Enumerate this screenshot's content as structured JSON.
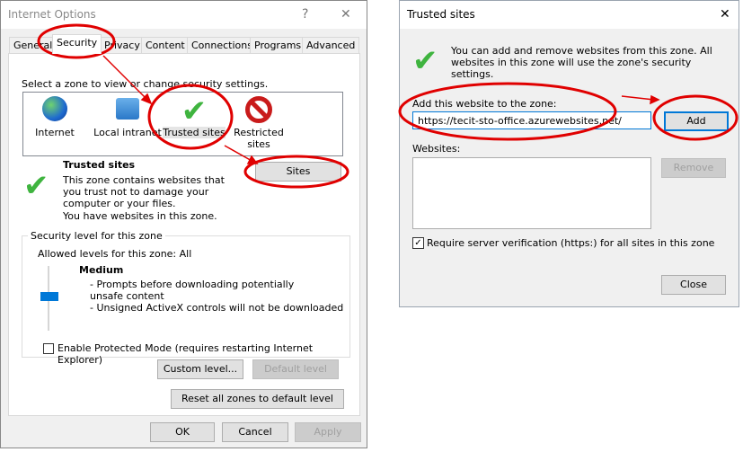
{
  "internet_options": {
    "title": "Internet Options",
    "help": "?",
    "close": "✕",
    "tabs": [
      "General",
      "Security",
      "Privacy",
      "Content",
      "Connections",
      "Programs",
      "Advanced"
    ],
    "active_tab": "Security",
    "zone_prompt": "Select a zone to view or change security settings.",
    "zones": [
      {
        "label": "Internet",
        "icon": "globe-icon"
      },
      {
        "label": "Local intranet",
        "icon": "intranet-icon"
      },
      {
        "label": "Trusted sites",
        "icon": "checkmark-icon"
      },
      {
        "label": "Restricted sites",
        "icon": "restricted-icon"
      }
    ],
    "zone_title": "Trusted sites",
    "zone_desc": "This zone contains websites that you trust not to damage your computer or your files.",
    "zone_note": "You have websites in this zone.",
    "sites_button": "Sites",
    "security_level_group": "Security level for this zone",
    "allowed_levels": "Allowed levels for this zone: All",
    "level_name": "Medium",
    "level_bullets": [
      "- Prompts before downloading potentially unsafe content",
      "- Unsigned ActiveX controls will not be downloaded"
    ],
    "protected_mode": {
      "label": "Enable Protected Mode (requires restarting Internet Explorer)",
      "checked": false
    },
    "custom_level": "Custom level...",
    "default_level": "Default level",
    "reset_all": "Reset all zones to default level",
    "ok": "OK",
    "cancel": "Cancel",
    "apply": "Apply"
  },
  "trusted_sites": {
    "title": "Trusted sites",
    "close": "✕",
    "info": "You can add and remove websites from this zone. All websites in this zone will use the zone's security settings.",
    "add_label": "Add this website to the zone:",
    "url_value": "https://tecit-sto-office.azurewebsites.net/",
    "add_button": "Add",
    "websites_label": "Websites:",
    "remove_button": "Remove",
    "require_https": {
      "label": "Require server verification (https:) for all sites in this zone",
      "checked": true
    },
    "close_button": "Close"
  },
  "annotation_color": "#e00000"
}
